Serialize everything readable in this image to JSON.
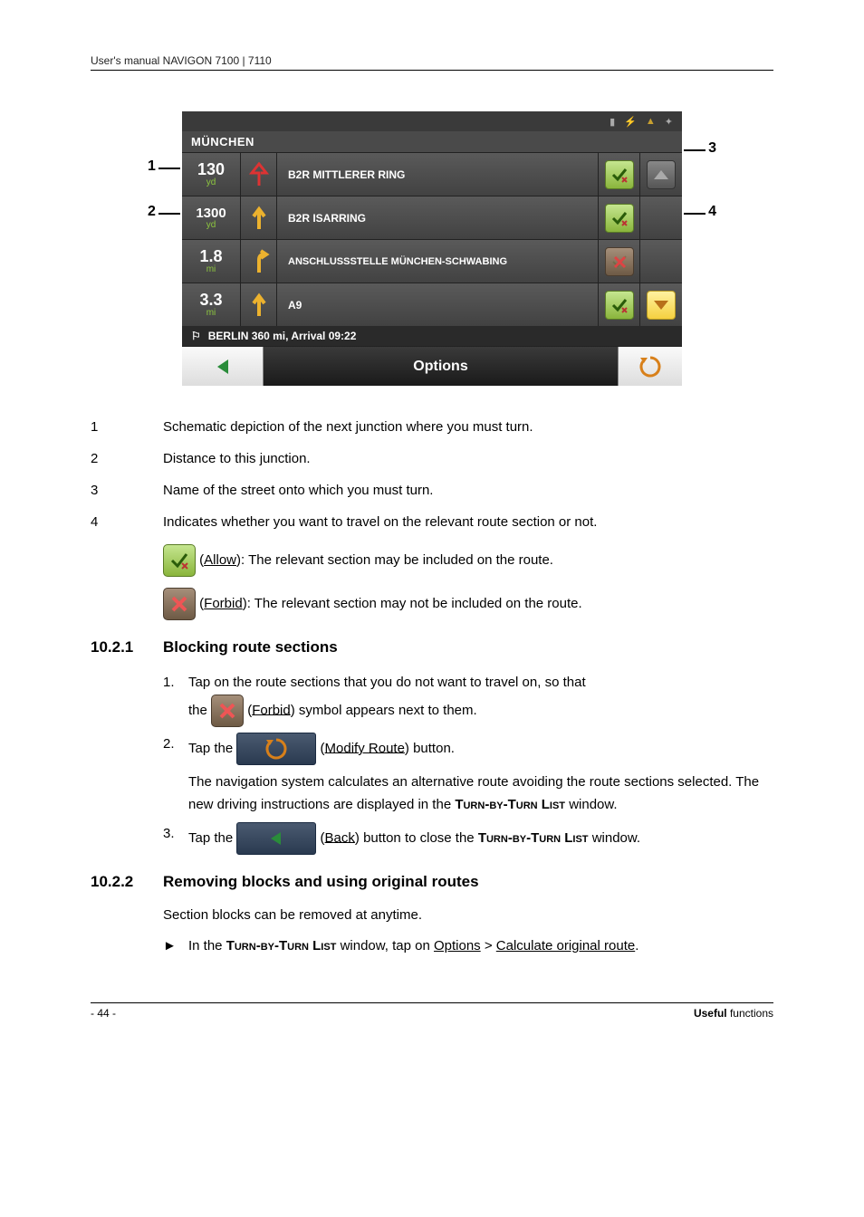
{
  "header": "User's manual NAVIGON 7100 | 7110",
  "nav": {
    "title": "MÜNCHEN",
    "rows": [
      {
        "distance": "130",
        "unit": "yd",
        "street": "B2R MITTLERER RING",
        "allow": true,
        "extra": "triangle"
      },
      {
        "distance": "1300",
        "unit": "yd",
        "street": "B2R ISARRING",
        "allow": true,
        "extra": null
      },
      {
        "distance": "1.8",
        "unit": "mi",
        "street": "ANSCHLUSSSTELLE MÜNCHEN-SCHWABING",
        "allow": false,
        "extra": null
      },
      {
        "distance": "3.3",
        "unit": "mi",
        "street": "A9",
        "allow": true,
        "extra": "down"
      }
    ],
    "status": "BERLIN 360 mi, Arrival 09:22",
    "options": "Options"
  },
  "callouts": {
    "c1": "1",
    "c2": "2",
    "c3": "3",
    "c4": "4"
  },
  "definitions": {
    "d1": "Schematic depiction of the next junction where you must turn.",
    "d2": "Distance to this junction.",
    "d3": "Name of the street onto which you must turn.",
    "d4": "Indicates whether you want to travel on the relevant route section or not.",
    "allow_label": "Allow",
    "allow_text": "): The relevant section may be included on the route.",
    "forbid_label": "Forbid",
    "forbid_text": "): The relevant section may not be included on the route."
  },
  "s1": {
    "num": "10.2.1",
    "title": "Blocking route sections",
    "step1a": "Tap on the route sections that you do not want to travel on, so that",
    "step1b_pre": "the ",
    "step1b_label": "Forbid",
    "step1b_post": ") symbol appears next to them.",
    "step2_pre": "Tap the ",
    "step2_label": "Modify Route",
    "step2_post": ") button.",
    "step2_result_pre": "The navigation system calculates an alternative route avoiding the route sections selected. The new driving instructions are displayed in the ",
    "step2_window": "Turn-by-Turn List",
    "step2_result_post": " window.",
    "step3_pre": "Tap the ",
    "step3_label": "Back",
    "step3_mid": ") button to close the ",
    "step3_window": "Turn-by-Turn List",
    "step3_post": "window."
  },
  "s2": {
    "num": "10.2.2",
    "title": "Removing blocks and using original routes",
    "p1": "Section blocks can be removed at anytime.",
    "b1_pre": "In the ",
    "b1_window": "Turn-by-Turn List",
    "b1_mid": " window, tap on ",
    "b1_opt": "Options",
    "b1_gt": " > ",
    "b1_calc": "Calculate original route",
    "b1_post": "."
  },
  "footer": {
    "page": "- 44 -",
    "label_bold": "Useful",
    "label_rest": " functions"
  }
}
